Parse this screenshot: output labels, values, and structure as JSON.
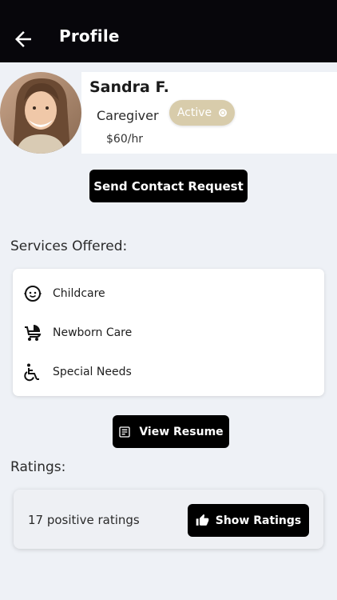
{
  "header": {
    "title": "Profile",
    "back_icon": "arrow-left-icon"
  },
  "profile": {
    "name": "Sandra F.",
    "role": "Caregiver",
    "rate": "$60/hr",
    "status": "Active",
    "avatar": "avatar-photo"
  },
  "actions": {
    "contact_label": "Send Contact Request",
    "resume_label": "View Resume",
    "show_ratings_label": "Show Ratings"
  },
  "services": {
    "title": "Services Offered:",
    "items": [
      {
        "label": "Childcare",
        "icon": "baby-face-icon"
      },
      {
        "label": "Newborn Care",
        "icon": "stroller-icon"
      },
      {
        "label": "Special Needs",
        "icon": "wheelchair-icon"
      }
    ]
  },
  "ratings": {
    "title": "Ratings:",
    "summary": "17 positive ratings"
  },
  "colors": {
    "header_bg": "#07060b",
    "page_bg": "#eef1f6",
    "status_badge": "#d8ccab",
    "button_bg": "#000000"
  }
}
